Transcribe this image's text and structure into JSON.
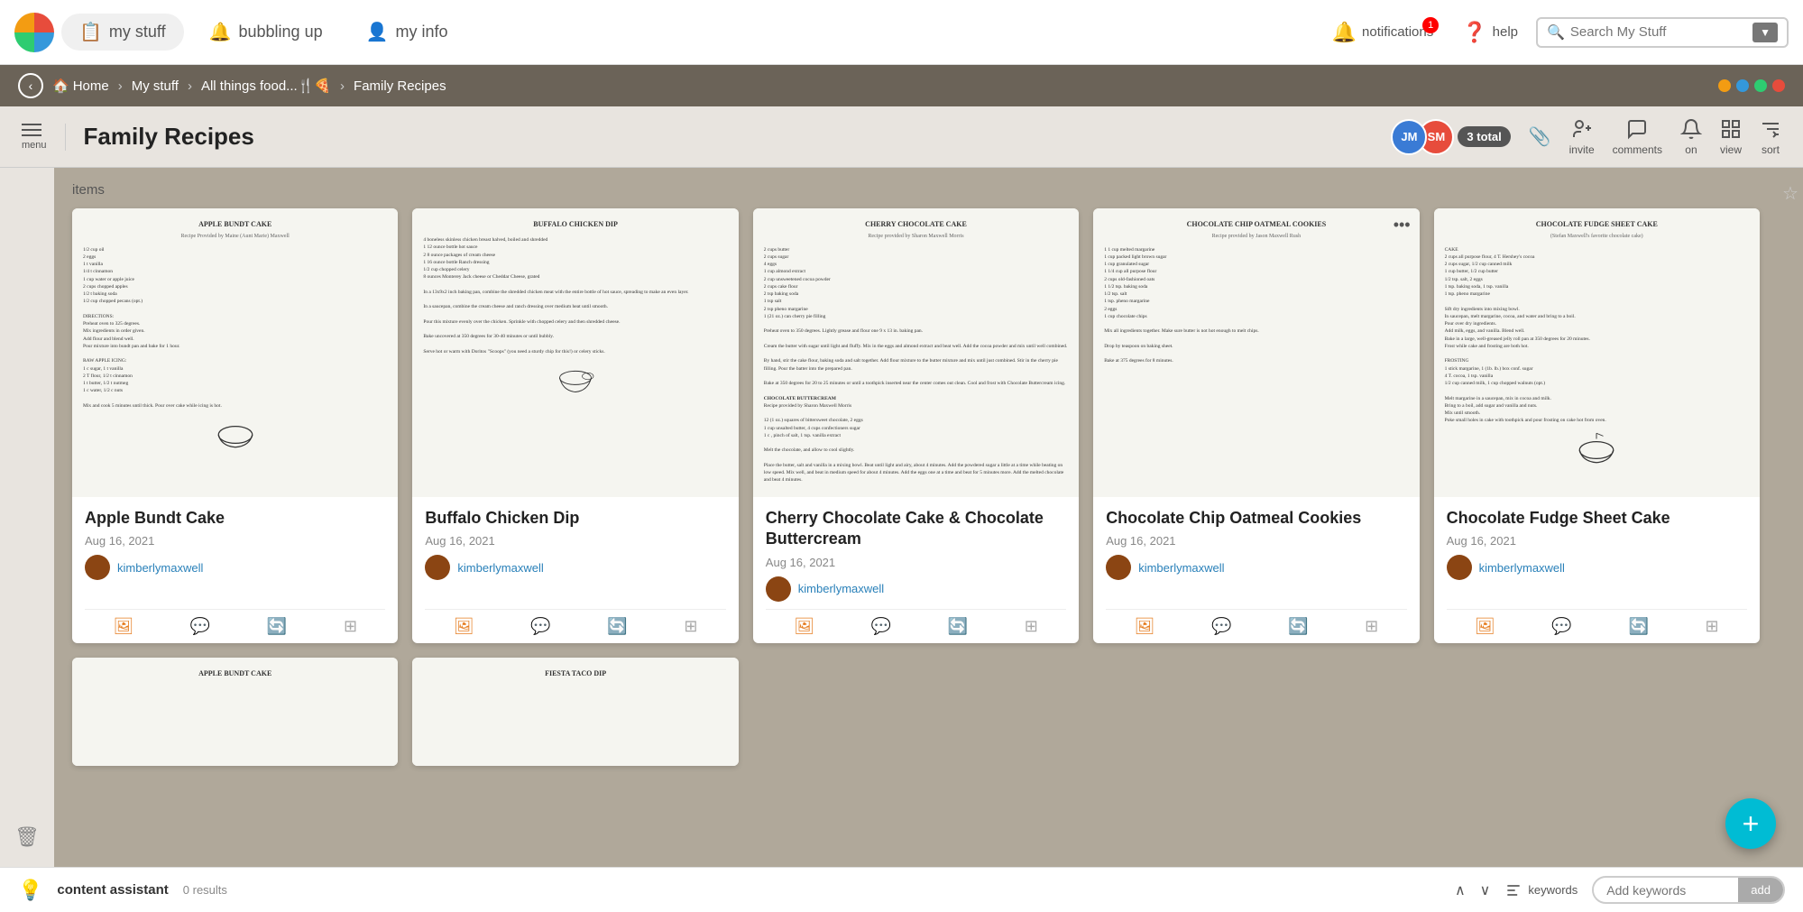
{
  "topnav": {
    "tabs": [
      {
        "id": "my-stuff",
        "label": "my stuff",
        "icon": "📋",
        "active": true
      },
      {
        "id": "bubbling-up",
        "label": "bubbling up",
        "icon": "🔔",
        "active": false
      },
      {
        "id": "my-info",
        "label": "my info",
        "icon": "👤",
        "active": false
      }
    ],
    "notifications_label": "notifications",
    "notifications_count": "1",
    "help_label": "help",
    "search_placeholder": "Search My Stuff"
  },
  "breadcrumb": {
    "home": "Home",
    "my_stuff": "My stuff",
    "folder": "All things food...🍴🍕",
    "current": "Family Recipes"
  },
  "toolbar": {
    "menu_label": "menu",
    "title": "Family Recipes",
    "collaborators": [
      {
        "initials": "JM",
        "color": "#3a7bd5"
      },
      {
        "initials": "SM",
        "color": "#e74c3c"
      }
    ],
    "total_label": "3 total",
    "invite_label": "invite",
    "comments_label": "comments",
    "on_label": "on",
    "view_label": "view",
    "sort_label": "sort"
  },
  "content": {
    "items_label": "items",
    "cards": [
      {
        "id": "apple-bundt-cake",
        "title": "Apple Bundt Cake",
        "date": "Aug 16, 2021",
        "user": "kimberlymaxwell",
        "recipe_title": "APPLE BUNDT CAKE",
        "recipe_subtitle": "Recipe Provided by Maine (Aunt Marie) Maxwell"
      },
      {
        "id": "buffalo-chicken-dip",
        "title": "Buffalo Chicken Dip",
        "date": "Aug 16, 2021",
        "user": "kimberlymaxwell",
        "recipe_title": "BUFFALO CHICKEN DIP",
        "recipe_subtitle": ""
      },
      {
        "id": "cherry-chocolate-cake",
        "title": "Cherry Chocolate Cake & Chocolate Buttercream",
        "date": "Aug 16, 2021",
        "user": "kimberlymaxwell",
        "recipe_title": "CHERRY CHOCOLATE CAKE",
        "recipe_subtitle": "Recipe provided by Sharon Maxwell Morris"
      },
      {
        "id": "chocolate-chip-oatmeal",
        "title": "Chocolate Chip Oatmeal Cookies",
        "date": "Aug 16, 2021",
        "user": "kimberlymaxwell",
        "recipe_title": "CHOCOLATE CHIP OATMEAL COOKIES",
        "recipe_subtitle": "Recipe provided by Jason Maxwell Rush",
        "has_more": true
      },
      {
        "id": "chocolate-fudge-sheet",
        "title": "Chocolate Fudge Sheet Cake",
        "date": "Aug 16, 2021",
        "user": "kimberlymaxwell",
        "recipe_title": "CHOCOLATE FUDGE SHEET CAKE",
        "recipe_subtitle": "(Stefan Maxwell's favorite chocolate cake)"
      }
    ],
    "partial_cards": [
      {
        "id": "partial-1",
        "recipe_title": "APPLE BUNDT CAKE"
      },
      {
        "id": "partial-2",
        "recipe_title": "FIESTA TACO DIP"
      }
    ]
  },
  "bottom_bar": {
    "assistant_label": "content assistant",
    "results_label": "0 results",
    "keywords_label": "keywords",
    "add_label": "add",
    "keywords_placeholder": "Add keywords"
  },
  "fab": {
    "label": "+"
  }
}
